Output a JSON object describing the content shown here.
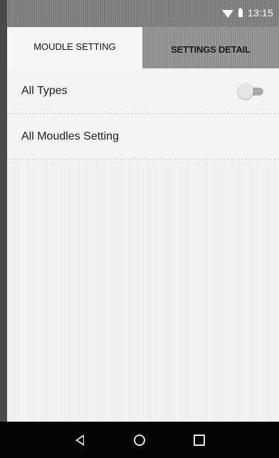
{
  "status_bar": {
    "time": "13:15",
    "icons": [
      "wifi-icon",
      "battery-icon"
    ]
  },
  "tabs": [
    {
      "label": "MOUDLE SETTING",
      "selected": true
    },
    {
      "label": "SETTINGS DETAIL",
      "selected": false
    }
  ],
  "list": {
    "items": [
      {
        "label": "All Types",
        "control": "toggle",
        "toggle_on": false
      },
      {
        "label": "All Moudles Setting"
      }
    ]
  },
  "nav_bar": {
    "icons": [
      "back-icon",
      "home-icon",
      "recents-icon"
    ]
  },
  "colors": {
    "status_bar": "#7b7b7b",
    "tab_inactive": "#8d8d8d",
    "nav_bar": "#050505"
  }
}
